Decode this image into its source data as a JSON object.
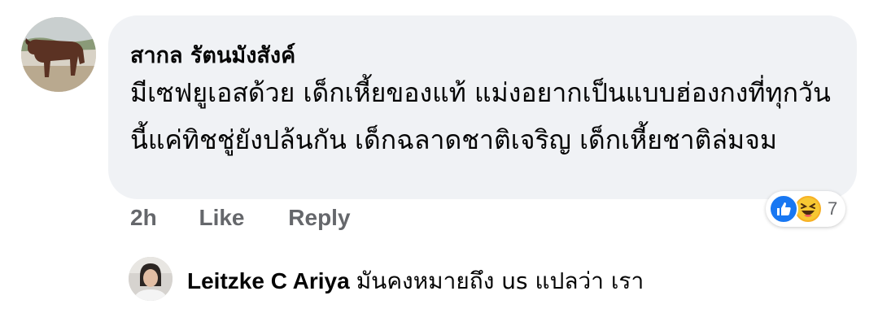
{
  "comment": {
    "author": "สากล รัตนมังสังค์",
    "text": "มีเซฟยูเอสด้วย เด็กเหี้ยของแท้ แม่งอยากเป็นแบบฮ่องกงที่ทุกวันนี้แค่ทิชชู่ยังปล้นกัน เด็กฉลาดชาติเจริญ เด็กเหี้ยชาติล่มจม",
    "avatar_icon": "cow-photo-avatar"
  },
  "actions": {
    "time": "2h",
    "like_label": "Like",
    "reply_label": "Reply"
  },
  "reactions": {
    "icons": [
      "like-icon",
      "haha-icon"
    ],
    "count": "7",
    "colors": {
      "like": "#1877f2",
      "haha": "#f7b125"
    }
  },
  "reply": {
    "author": "Leitzke C Ariya",
    "text": "มันคงหมายถึง us แปลว่า เรา",
    "avatar_icon": "person-photo-avatar"
  }
}
